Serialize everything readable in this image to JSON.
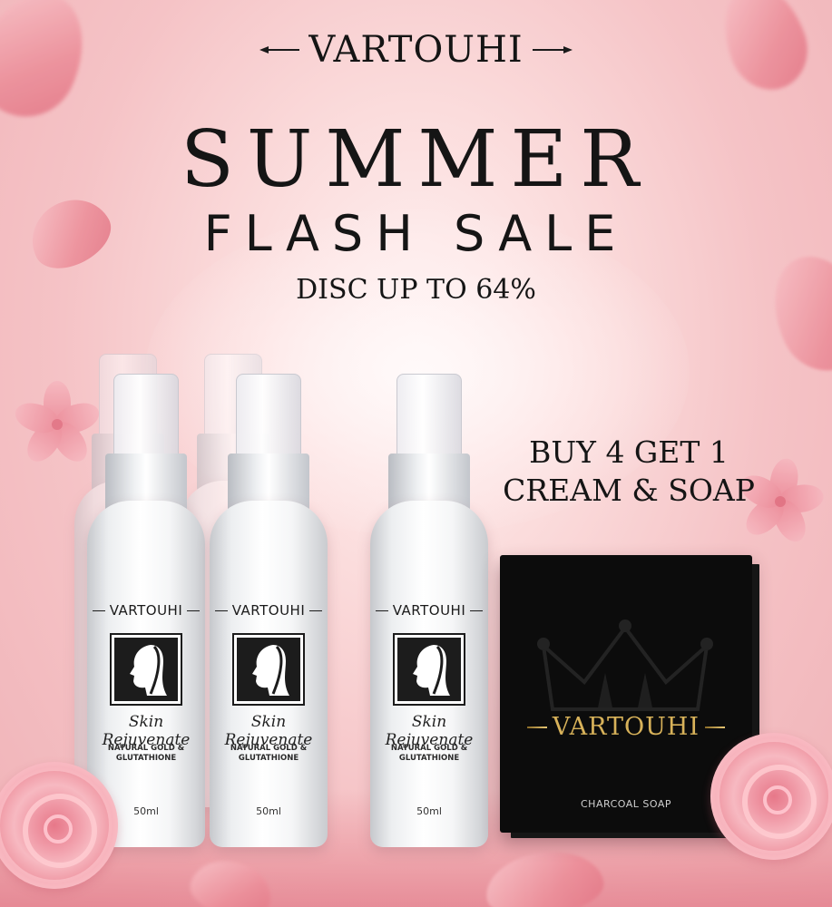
{
  "brand": "VARTOUHI",
  "headline": {
    "line1": "SUMMER",
    "line2": "FLASH SALE",
    "discount": "DISC UP TO 64%"
  },
  "promo": {
    "line1": "BUY 4 GET 1",
    "line2": "CREAM & SOAP"
  },
  "bottle": {
    "brand": "VARTOUHI",
    "name": "Skin Rejuvenate",
    "ingredients": "NATURAL GOLD &\nGLUTATHIONE",
    "volume": "50ml"
  },
  "soap": {
    "brand": "VARTOUHI",
    "type": "CHARCOAL SOAP"
  },
  "colors": {
    "background": "#f5c3c6",
    "text": "#151515",
    "gold": "#d8b25a",
    "soap_box": "#0c0c0c"
  },
  "icons": [
    "petal-icon",
    "flower-icon",
    "rose-icon",
    "woman-silhouette-icon",
    "crown-icon"
  ]
}
